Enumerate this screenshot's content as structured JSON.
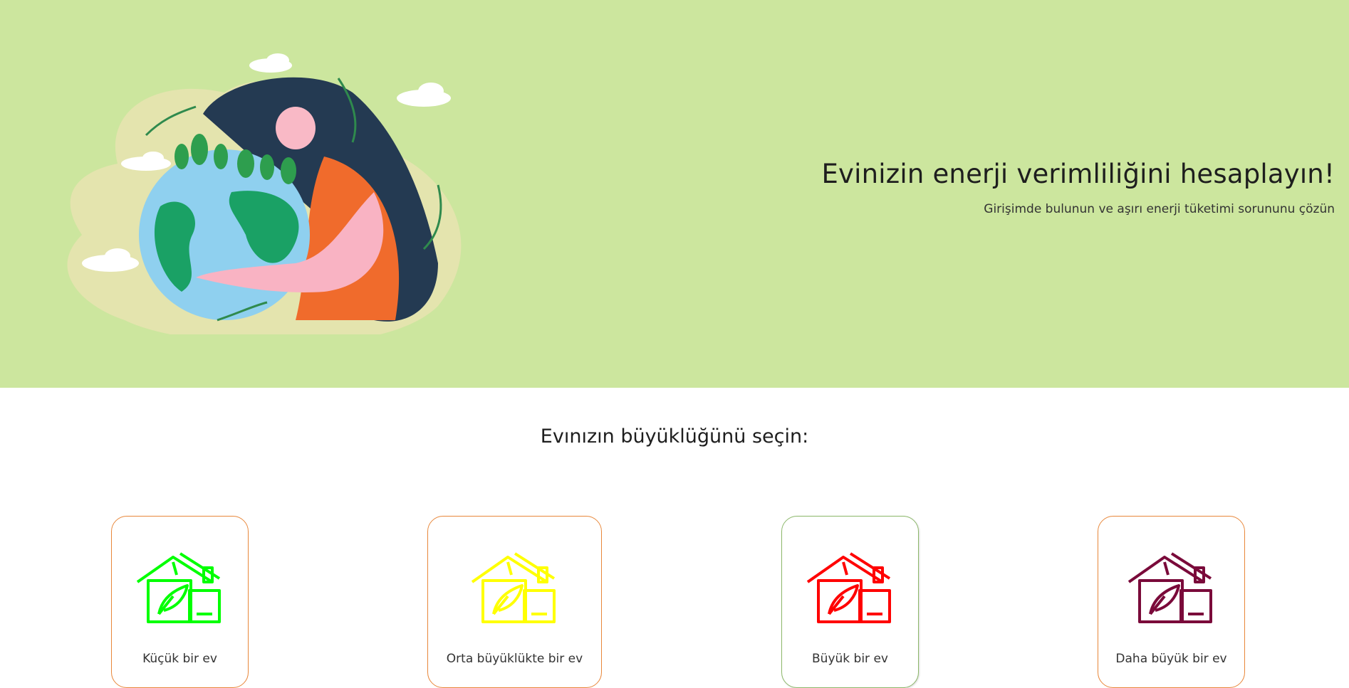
{
  "hero": {
    "title": "Evinizin enerji verimliliğini hesaplayın!",
    "subtitle": "Girişimde bulunun ve aşırı enerji tüketimi sorununu çözün",
    "background": "#cce69e"
  },
  "size_section": {
    "title": "Evınızın büyüklüğünü seçin:"
  },
  "cards": [
    {
      "label": "Küçük bir ev",
      "icon": "eco-house-icon",
      "color": "#00ff00"
    },
    {
      "label": "Orta büyüklükte bir ev",
      "icon": "eco-house-icon",
      "color": "#ffff00"
    },
    {
      "label": "Büyük bir ev",
      "icon": "eco-house-icon",
      "color": "#ff0000"
    },
    {
      "label": "Daha büyük bir ev",
      "icon": "eco-house-icon",
      "color": "#7a0a3a"
    }
  ],
  "card_border_color": "#e8873a"
}
